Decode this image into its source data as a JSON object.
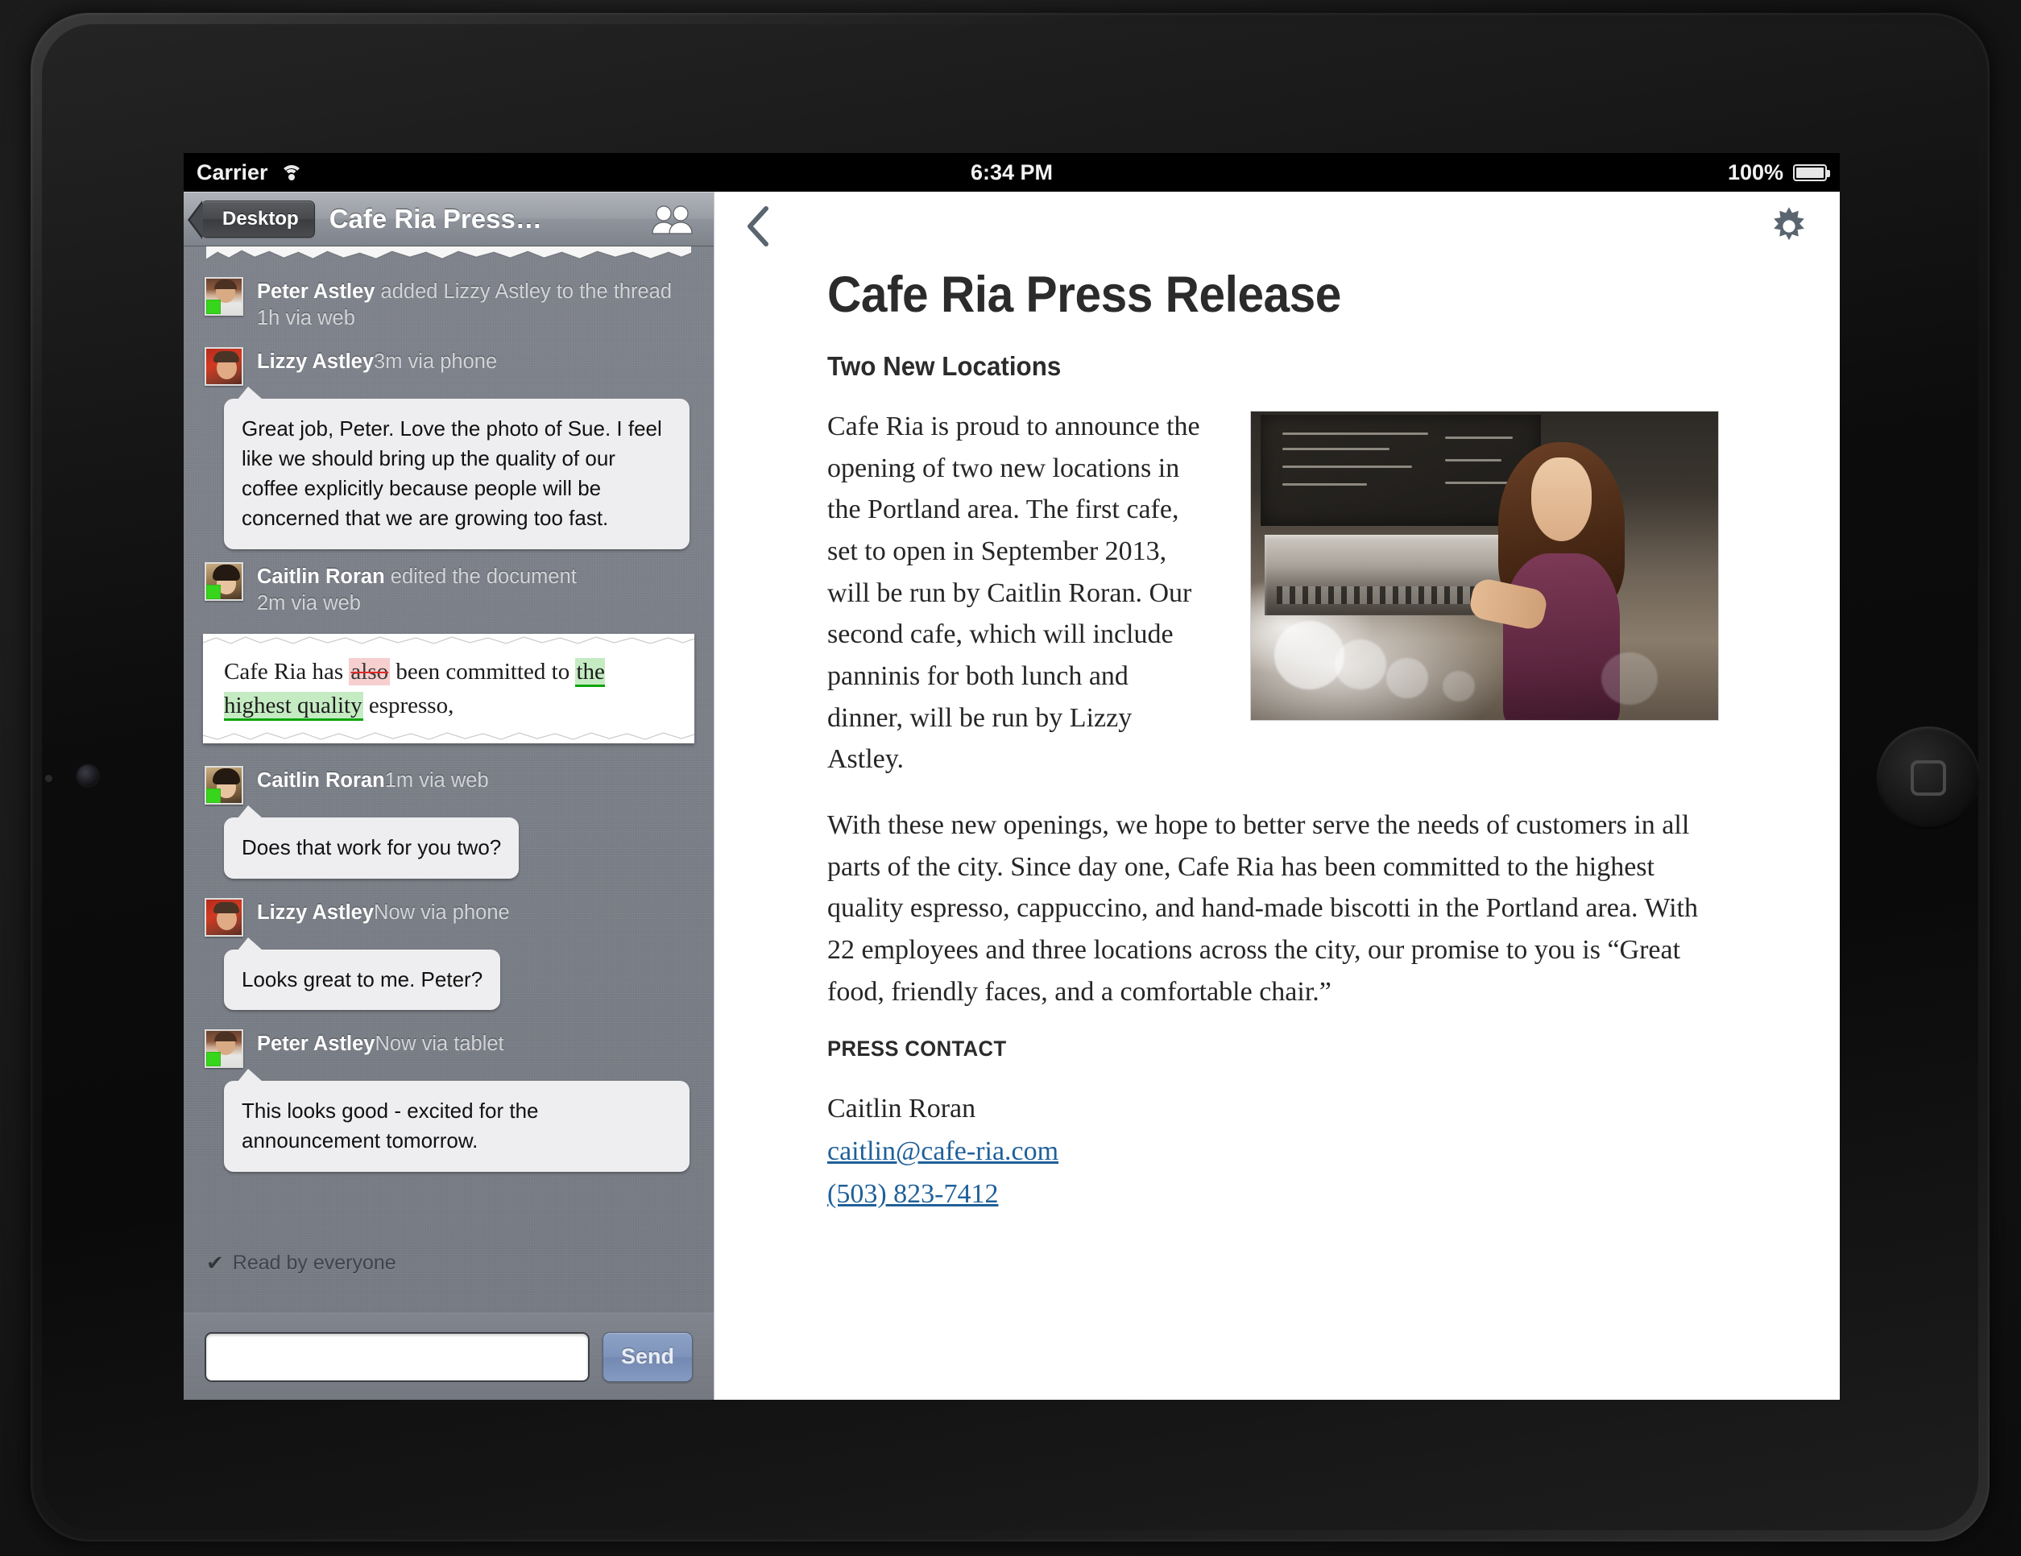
{
  "status_bar": {
    "carrier": "Carrier",
    "wifi_icon": "wifi-icon",
    "time": "6:34 PM",
    "battery_percent": "100%",
    "battery_icon": "battery-full-icon"
  },
  "left_pane": {
    "nav": {
      "back_label": "Desktop",
      "title": "Cafe Ria Press…",
      "people_icon": "people-icon"
    },
    "messages": [
      {
        "author": "Peter Astley",
        "action": " added Lizzy Astley to the thread ",
        "meta": "1h via web",
        "avatar": "av-peter",
        "type": "event"
      },
      {
        "author": "Lizzy Astley",
        "action": " ",
        "meta": "3m via phone",
        "avatar": "av-lizzy",
        "type": "bubble",
        "body": "Great job, Peter. Love the photo of Sue. I feel like we should bring up the quality of our coffee explicitly because people will be concerned that we are growing too fast."
      },
      {
        "author": "Caitlin Roran",
        "action": " edited the document ",
        "meta": "2m via web",
        "avatar": "av-caitlin",
        "type": "edit",
        "edit": {
          "before": "Cafe Ria has ",
          "deleted": "also",
          "middle": " been committed to ",
          "inserted": "the highest quality",
          "after": " espresso,"
        }
      },
      {
        "author": "Caitlin Roran",
        "action": " ",
        "meta": "1m via web",
        "avatar": "av-caitlin",
        "type": "bubble",
        "body": "Does that work for you two?"
      },
      {
        "author": "Lizzy Astley",
        "action": " ",
        "meta": "Now via phone",
        "avatar": "av-lizzy",
        "type": "bubble",
        "body": "Looks great to me. Peter?"
      },
      {
        "author": "Peter Astley",
        "action": " ",
        "meta": "Now via tablet",
        "avatar": "av-peter",
        "type": "bubble",
        "body": "This looks good - excited for the announcement tomorrow."
      }
    ],
    "read_receipt": {
      "check_icon": "check-icon",
      "label": "Read by everyone"
    },
    "composer": {
      "input_value": "",
      "input_placeholder": "",
      "send_label": "Send"
    }
  },
  "right_pane": {
    "toolbar": {
      "back_icon": "chevron-left-icon",
      "settings_icon": "gear-icon"
    },
    "document": {
      "title": "Cafe Ria Press Release",
      "subtitle": "Two New Locations",
      "photo_alt": "barista-photo",
      "paragraphs": [
        "Cafe Ria is proud to announce the opening of two new locations in the Portland area. The first cafe, set to open in September 2013, will be run by Caitlin Roran. Our second cafe, which will include panninis for both lunch and dinner, will be run by Lizzy Astley.",
        "With these new openings, we hope to better serve the needs of customers in all parts of the city. Since day one, Cafe Ria has been committed to the highest quality espresso, cappuccino, and hand-made biscotti in the Portland area. With 22 employees and three locations across the city, our promise to you is “Great food, friendly faces, and a comfortable chair.”"
      ],
      "press_contact_label": "PRESS CONTACT",
      "contact_name": "Caitlin Roran",
      "contact_email": "caitlin@cafe-ria.com",
      "contact_phone": "(503) 823-7412"
    }
  },
  "colors": {
    "link": "#1f6099",
    "accent_send": "#7e93ba",
    "status_online": "#37d51b",
    "deleted_bg": "#f7cfcf",
    "inserted_bg": "#c5ebc3"
  }
}
